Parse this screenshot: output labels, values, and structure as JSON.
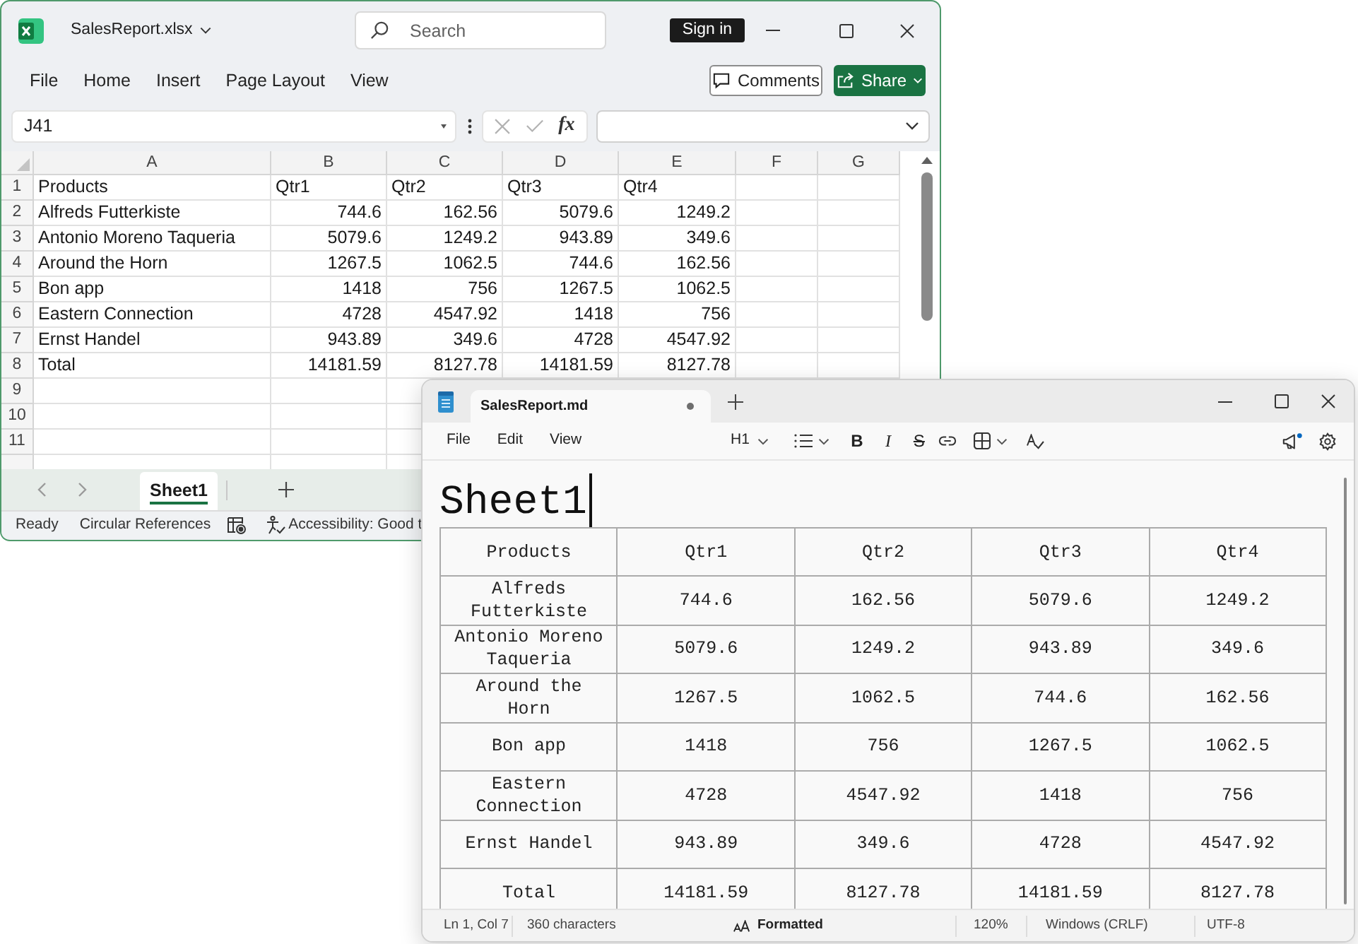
{
  "excel": {
    "file_name": "SalesReport.xlsx",
    "search": {
      "placeholder": "Search"
    },
    "sign_in": "Sign in",
    "ribbon_tabs": [
      "File",
      "Home",
      "Insert",
      "Page Layout",
      "View"
    ],
    "comments": "Comments",
    "share": "Share",
    "name_box": "J41",
    "formula_label": "fx",
    "columns": [
      "A",
      "B",
      "C",
      "D",
      "E",
      "F",
      "G"
    ],
    "rows": [
      {
        "number": "1",
        "kind": "header",
        "cells": [
          "Products",
          "Qtr1",
          "Qtr2",
          "Qtr3",
          "Qtr4"
        ]
      },
      {
        "number": "2",
        "kind": "data",
        "cells": [
          "Alfreds Futterkiste",
          "744.6",
          "162.56",
          "5079.6",
          "1249.2"
        ]
      },
      {
        "number": "3",
        "kind": "data",
        "cells": [
          "Antonio Moreno Taqueria",
          "5079.6",
          "1249.2",
          "943.89",
          "349.6"
        ]
      },
      {
        "number": "4",
        "kind": "data",
        "cells": [
          "Around the Horn",
          "1267.5",
          "1062.5",
          "744.6",
          "162.56"
        ]
      },
      {
        "number": "5",
        "kind": "data",
        "cells": [
          "Bon app",
          "1418",
          "756",
          "1267.5",
          "1062.5"
        ]
      },
      {
        "number": "6",
        "kind": "data",
        "cells": [
          "Eastern Connection",
          "4728",
          "4547.92",
          "1418",
          "756"
        ]
      },
      {
        "number": "7",
        "kind": "data",
        "cells": [
          "Ernst Handel",
          "943.89",
          "349.6",
          "4728",
          "4547.92"
        ]
      },
      {
        "number": "8",
        "kind": "data",
        "cells": [
          "Total",
          "14181.59",
          "8127.78",
          "14181.59",
          "8127.78"
        ]
      },
      {
        "number": "9",
        "kind": "empty"
      },
      {
        "number": "10",
        "kind": "empty"
      },
      {
        "number": "11",
        "kind": "empty"
      }
    ],
    "sheet_tabs": [
      {
        "label": "Sheet1",
        "selected": true
      }
    ],
    "status_bar": {
      "mode": "Ready",
      "circular_references": "Circular References",
      "accessibility": "Accessibility: Good t"
    }
  },
  "notepad": {
    "tabs": [
      {
        "title": "SalesReport.md",
        "selected": true,
        "modified": true
      }
    ],
    "menu": [
      "File",
      "Edit",
      "View"
    ],
    "heading_level": "H1",
    "toolbar": [
      {
        "kind": "bold",
        "label": "B"
      },
      {
        "kind": "italic",
        "label": "I"
      },
      {
        "kind": "strikethrough",
        "label": "S"
      }
    ],
    "heading": "Sheet1",
    "table": {
      "columns": [
        "Products",
        "Qtr1",
        "Qtr2",
        "Qtr3",
        "Qtr4"
      ],
      "rows": [
        [
          "Alfreds Futterkiste",
          "744.6",
          "162.56",
          "5079.6",
          "1249.2"
        ],
        [
          "Antonio Moreno Taqueria",
          "5079.6",
          "1249.2",
          "943.89",
          "349.6"
        ],
        [
          "Around the Horn",
          "1267.5",
          "1062.5",
          "744.6",
          "162.56"
        ],
        [
          "Bon app",
          "1418",
          "756",
          "1267.5",
          "1062.5"
        ],
        [
          "Eastern Connection",
          "4728",
          "4547.92",
          "1418",
          "756"
        ],
        [
          "Ernst Handel",
          "943.89",
          "349.6",
          "4728",
          "4547.92"
        ],
        [
          "Total",
          "14181.59",
          "8127.78",
          "14181.59",
          "8127.78"
        ]
      ]
    },
    "status_bar": {
      "position": "Ln 1, Col 7",
      "characters": "360 characters",
      "view_mode": "Formatted",
      "zoom": "120%",
      "line_ending": "Windows (CRLF)",
      "encoding": "UTF-8"
    }
  }
}
